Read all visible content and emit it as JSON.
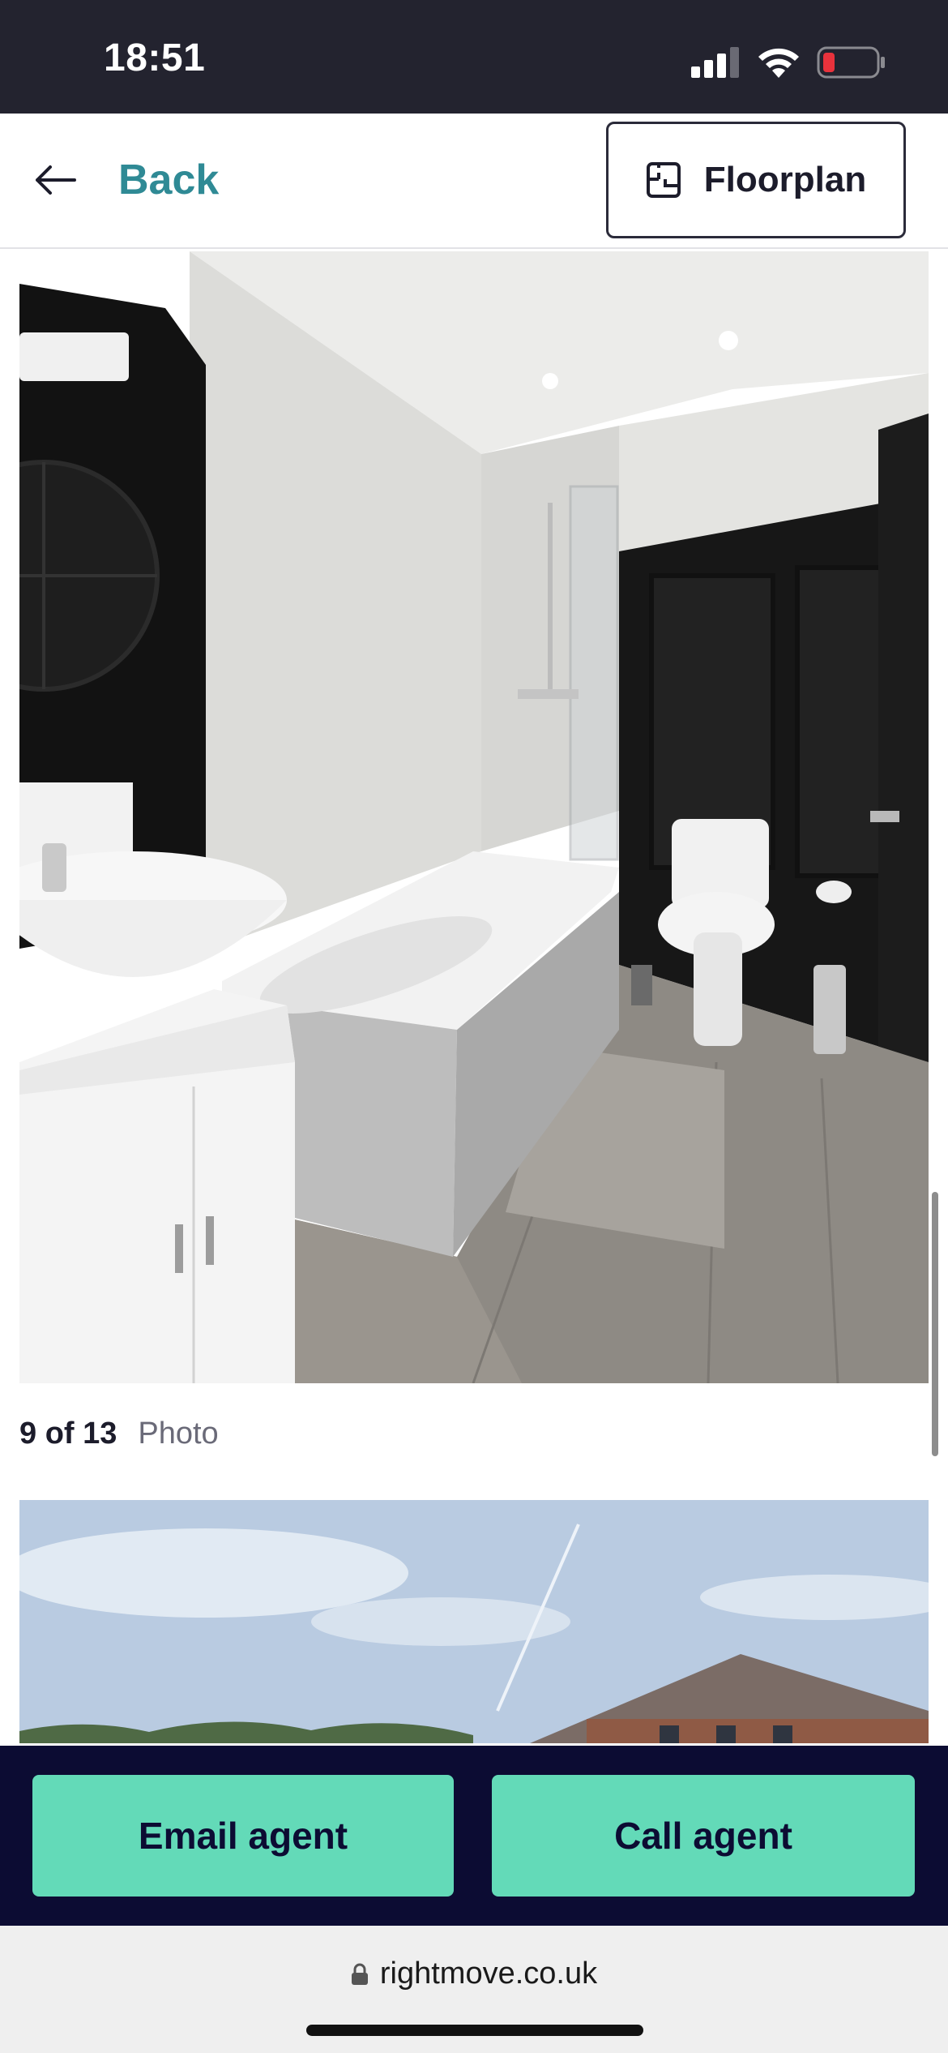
{
  "status_bar": {
    "time": "18:51",
    "icons": [
      "cellular-signal-icon",
      "wifi-icon",
      "battery-low-icon"
    ],
    "battery_color": "#e8323c"
  },
  "header": {
    "back_label": "Back",
    "back_icon": "arrow-left-icon",
    "floorplan_label": "Floorplan",
    "floorplan_icon": "floorplan-icon",
    "accent_color": "#2f8a95"
  },
  "gallery": {
    "current_photo": {
      "counter": "9 of 13",
      "type_label": "Photo",
      "subject": "bathroom"
    },
    "next_photo": {
      "subject": "house-exterior"
    }
  },
  "actions": {
    "email_label": "Email agent",
    "call_label": "Call agent",
    "button_color": "#63dab8",
    "bar_color": "#0c0c33"
  },
  "browser": {
    "url": "rightmove.co.uk",
    "lock_icon": "lock-icon"
  }
}
